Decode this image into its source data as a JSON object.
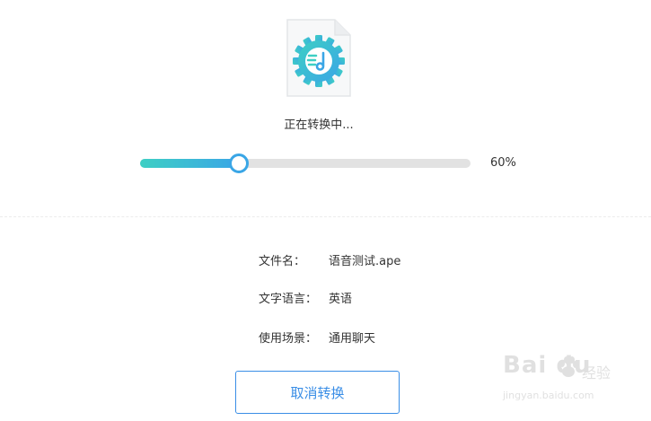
{
  "conversion": {
    "status_text": "正在转换中...",
    "progress_percent_text": "60%",
    "progress_value": 0.3
  },
  "file_info": {
    "filename_label": "文件名：",
    "filename_value": "语音测试.ape",
    "language_label": "文字语言：",
    "language_value": "英语",
    "scene_label": "使用场景：",
    "scene_value": "通用聊天"
  },
  "actions": {
    "cancel_label": "取消转换"
  },
  "watermark": {
    "brand": "Bai du",
    "brand_cn": "经验",
    "url": "jingyan.baidu.com"
  },
  "icons": {
    "file": "audio-file-gear-icon",
    "paw": "baidu-paw-icon"
  },
  "colors": {
    "accent": "#3a8ee6",
    "progress_start": "#3ecfc4",
    "progress_end": "#3aa6e6",
    "track": "#e2e2e2"
  }
}
